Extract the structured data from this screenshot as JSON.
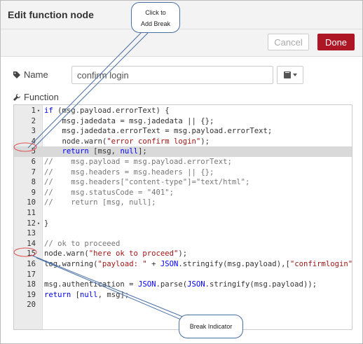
{
  "dialog": {
    "title": "Edit function node",
    "cancel_label": "Cancel",
    "done_label": "Done"
  },
  "name_field": {
    "label": "Name",
    "value": "confirm login",
    "icon": "tag-icon"
  },
  "function_field": {
    "label": "Function",
    "icon": "wrench-icon"
  },
  "library_button": {
    "icon": "book-icon"
  },
  "editor": {
    "highlighted_line": 5,
    "lines": [
      {
        "n": "1",
        "fold": true,
        "text": "if (msg.payload.errorText) {"
      },
      {
        "n": "2",
        "text": "    msg.jadedata = msg.jadedata || {};"
      },
      {
        "n": "3",
        "text": "    msg.jadedata.errorText = msg.payload.errorText;"
      },
      {
        "n": "4",
        "text": "    node.warn(\"error confirm login\");"
      },
      {
        "n": "5",
        "text": "    return [msg, null];"
      },
      {
        "n": "6",
        "text": "//    msg.payload = msg.payload.errorText;"
      },
      {
        "n": "7",
        "text": "//    msg.headers = msg.headers || {};"
      },
      {
        "n": "8",
        "text": "//    msg.headers[\"content-type\"]=\"text/html\";"
      },
      {
        "n": "9",
        "text": "//    msg.statusCode = \"401\";"
      },
      {
        "n": "10",
        "text": "//    return [msg, null];"
      },
      {
        "n": "11",
        "text": ""
      },
      {
        "n": "12",
        "fold": true,
        "text": "}"
      },
      {
        "n": "13",
        "text": ""
      },
      {
        "n": "14",
        "text": "// ok to proceeed"
      },
      {
        "n": "15",
        "text": "node.warn(\"here ok to proceed\");"
      },
      {
        "n": "16",
        "text": "log.warning(\"payload: \" + JSON.stringify(msg.payload),[\"confirmlogin\"]);"
      },
      {
        "n": "17",
        "text": ""
      },
      {
        "n": "18",
        "text": "msg.authentication = JSON.parse(JSON.stringify(msg.payload));"
      },
      {
        "n": "19",
        "text": "return [null, msg];"
      },
      {
        "n": "20",
        "text": ""
      }
    ]
  },
  "annotations": {
    "click_to_add_break": "Click to\nAdd Break",
    "break_indicator": "Break Indicator",
    "color": "#4a6fa5",
    "break_marker_color": "#e05050"
  },
  "colors": {
    "done_button": "#ad1625",
    "keyword": "#0000ff",
    "string": "#a31515",
    "comment": "#777777"
  }
}
